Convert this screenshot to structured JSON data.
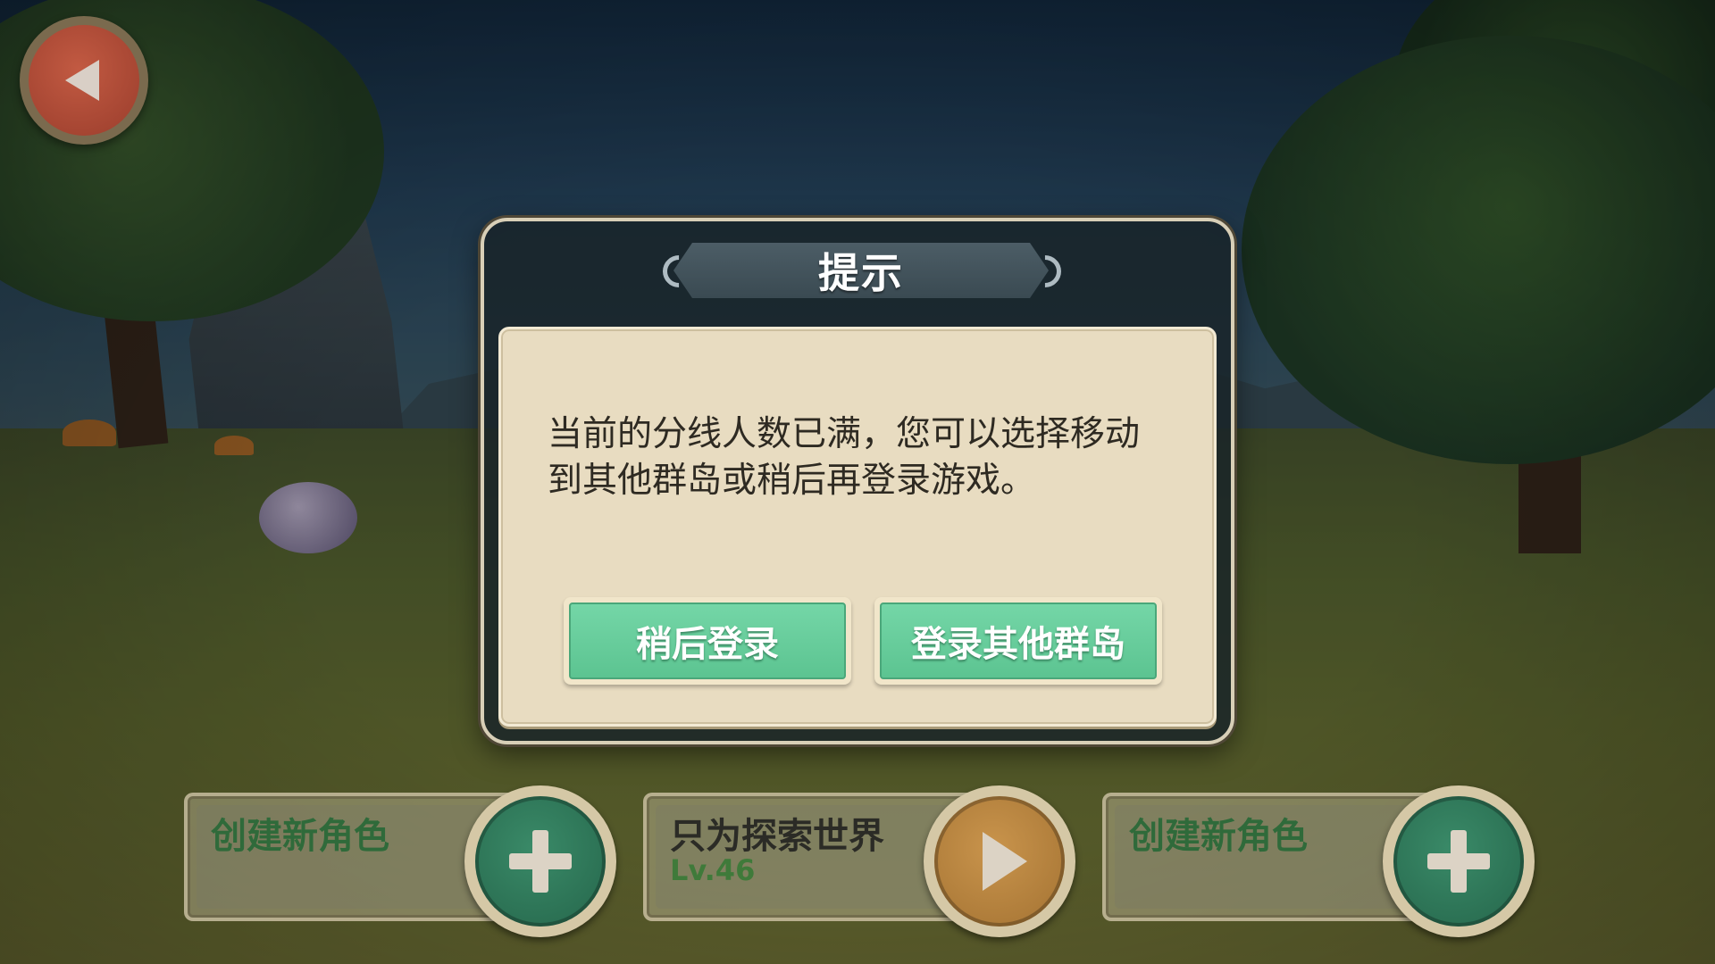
{
  "dialog": {
    "title": "提示",
    "message": "当前的分线人数已满，您可以选择移动到其他群岛或稍后再登录游戏。",
    "buttons": {
      "later_label": "稍后登录",
      "other_islands_label": "登录其他群岛"
    }
  },
  "slots": [
    {
      "name": "创建新角色",
      "level": "",
      "action_icon": "plus-icon"
    },
    {
      "name": "只为探索世界",
      "level": "Lv.46",
      "action_icon": "play-icon"
    },
    {
      "name": "创建新角色",
      "level": "",
      "action_icon": "plus-icon"
    }
  ],
  "icons": {
    "back": "back-arrow-icon"
  },
  "colors": {
    "button_green": "#5cc491",
    "panel_cream": "#e8dcc1",
    "back_red": "#b04c38",
    "plus_green": "#2f7a5a",
    "play_gold": "#b8843f"
  }
}
